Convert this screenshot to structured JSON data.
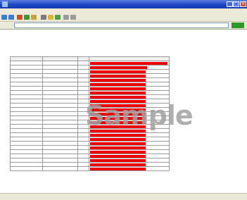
{
  "window": {
    "title": ""
  },
  "menubar": {
    "items": [
      "",
      "",
      "",
      "",
      "",
      ""
    ]
  },
  "address": {
    "label": "",
    "url": "",
    "go_label": ""
  },
  "page": {
    "breadcrumb": "",
    "section_label": ""
  },
  "table": {
    "headers": [
      "",
      "",
      "",
      ""
    ],
    "rows": [
      {
        "name": "",
        "desc": "",
        "num": "",
        "value": 1.0
      },
      {
        "name": "",
        "desc": "",
        "num": "",
        "value": 0.74
      },
      {
        "name": "",
        "desc": "",
        "num": "",
        "value": 0.72
      },
      {
        "name": "",
        "desc": "",
        "num": "",
        "value": 0.72
      },
      {
        "name": "",
        "desc": "",
        "num": "",
        "value": 0.72
      },
      {
        "name": "",
        "desc": "",
        "num": "",
        "value": 0.72
      },
      {
        "name": "",
        "desc": "",
        "num": "",
        "value": 0.72
      },
      {
        "name": "",
        "desc": "",
        "num": "",
        "value": 0.72
      },
      {
        "name": "",
        "desc": "",
        "num": "",
        "value": 0.72
      },
      {
        "name": "",
        "desc": "",
        "num": "",
        "value": 0.72
      },
      {
        "name": "",
        "desc": "",
        "num": "",
        "value": 0.72
      },
      {
        "name": "",
        "desc": "",
        "num": "",
        "value": 0.72
      },
      {
        "name": "",
        "desc": "",
        "num": "",
        "value": 0.72
      },
      {
        "name": "",
        "desc": "",
        "num": "",
        "value": 0.72
      },
      {
        "name": "",
        "desc": "",
        "num": "",
        "value": 0.72
      },
      {
        "name": "",
        "desc": "",
        "num": "",
        "value": 0.72
      },
      {
        "name": "",
        "desc": "",
        "num": "",
        "value": 0.72
      },
      {
        "name": "",
        "desc": "",
        "num": "",
        "value": 0.72
      },
      {
        "name": "",
        "desc": "",
        "num": "",
        "value": 0.72
      },
      {
        "name": "",
        "desc": "",
        "num": "",
        "value": 0.72
      },
      {
        "name": "",
        "desc": "",
        "num": "",
        "value": 0.72
      },
      {
        "name": "",
        "desc": "",
        "num": "",
        "value": 0.72
      },
      {
        "name": "",
        "desc": "",
        "num": "",
        "value": 0.72
      },
      {
        "name": "",
        "desc": "",
        "num": "",
        "value": 0.72
      },
      {
        "name": "",
        "desc": "",
        "num": "",
        "value": 0.72
      },
      {
        "name": "",
        "desc": "",
        "num": "",
        "value": 0.72
      }
    ]
  },
  "summary": {
    "title": "",
    "rows": [
      {
        "label": "",
        "value": ""
      },
      {
        "label": "",
        "value": ""
      },
      {
        "label": "",
        "value": ""
      },
      {
        "label": "",
        "value": ""
      }
    ]
  },
  "watermark": "Sample",
  "status": {
    "text": "",
    "zone": ""
  },
  "colors": {
    "titlebar": "#1f46c8",
    "bar": "#ee0000",
    "chrome": "#ece9d8",
    "watermark": "#a0a0a0",
    "go": "#2b9a2b"
  },
  "icons": {
    "app": "browser-icon",
    "minimize": "minimize-icon",
    "maximize": "maximize-icon",
    "close": "close-icon"
  }
}
